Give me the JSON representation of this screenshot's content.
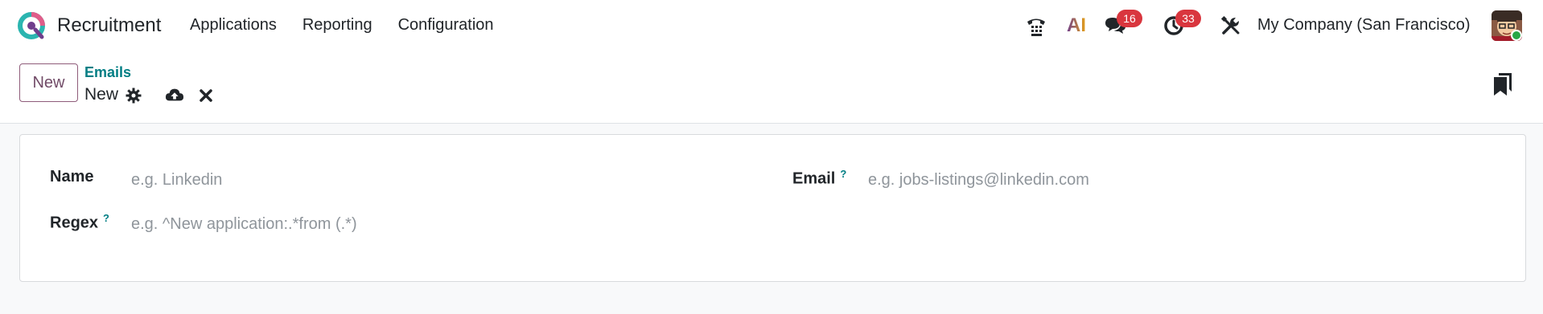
{
  "app": {
    "name": "Recruitment",
    "logo_icon": "odoo-q-logo-icon"
  },
  "menu": {
    "items": [
      "Applications",
      "Reporting",
      "Configuration"
    ]
  },
  "systray": {
    "phone_icon": "phone-icon",
    "ai_icon": "ai-icon",
    "ai_label": "AI",
    "messages_badge": "16",
    "activities_badge": "33",
    "debug_icon": "tools-icon",
    "company": "My Company (San Francisco)"
  },
  "control": {
    "new_label": "New",
    "breadcrumb_parent": "Emails",
    "breadcrumb_current": "New"
  },
  "form": {
    "name_label": "Name",
    "name_placeholder": "e.g. Linkedin",
    "email_label": "Email",
    "email_placeholder": "e.g. jobs-listings@linkedin.com",
    "regex_label": "Regex",
    "regex_placeholder": "e.g. ^New application:.*from (.*)",
    "help_mark": "?"
  },
  "colors": {
    "primary": "#714b67",
    "link": "#017e84",
    "badge": "#d9363e",
    "online": "#28a745"
  }
}
